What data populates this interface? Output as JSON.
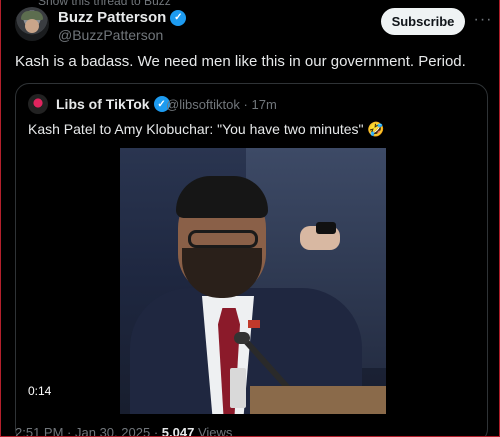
{
  "top_cut_text": "Show this thread to Buzz",
  "post": {
    "author_name": "Buzz Patterson",
    "author_handle": "@BuzzPatterson",
    "subscribe_label": "Subscribe",
    "more_label": "···",
    "text": "Kash is a badass. We need men like this in our government. Period."
  },
  "quoted": {
    "author_name": "Libs of TikTok",
    "author_handle": "@libsoftiktok",
    "time_ago": "17m",
    "separator": "·",
    "text": "Kash Patel to Amy Klobuchar: \"You have two minutes\" 🤣",
    "video_duration": "0:14"
  },
  "footer": {
    "time": "2:51 PM",
    "date": "Jan 30, 2025",
    "views_count": "5,047",
    "views_label": "Views"
  },
  "colors": {
    "background": "#000000",
    "text_primary": "#e7e9ea",
    "text_secondary": "#71767b",
    "verified": "#1d9bf0",
    "border": "#2f3336"
  }
}
